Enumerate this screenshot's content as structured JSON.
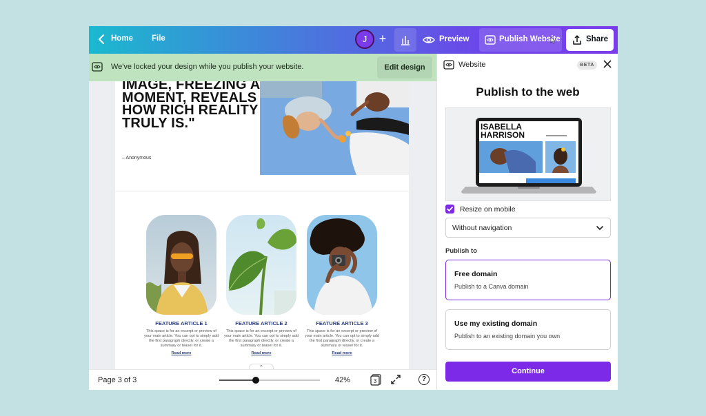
{
  "topbar": {
    "home_label": "Home",
    "file_label": "File",
    "avatar_initial": "J",
    "plus_symbol": "+",
    "preview_label": "Preview",
    "publish_label": "Publish Website",
    "share_label": "Share"
  },
  "banner": {
    "message": "We've locked your design while you publish your website.",
    "edit_label": "Edit design"
  },
  "page": {
    "quote": "IMAGE, FREEZING A MOMENT, REVEALS HOW RICH REALITY TRULY IS.\"",
    "author": "– Anonymous",
    "articles": [
      {
        "title": "FEATURE ARTICLE 1",
        "body": "This space is for an excerpt or preview of your main article. You can opt to simply add the first paragraph directly, or create a summary or teaser for it.",
        "more": "Read more"
      },
      {
        "title": "FEATURE ARTICLE 2",
        "body": "This space is for an excerpt or preview of your main article. You can opt to simply add the first paragraph directly, or create a summary or teaser for it.",
        "more": "Read more"
      },
      {
        "title": "FEATURE ARTICLE 3",
        "body": "This space is for an excerpt or preview of your main article. You can opt to simply add the first paragraph directly, or create a summary or teaser for it.",
        "more": "Read more"
      }
    ]
  },
  "bottombar": {
    "page_indicator": "Page 3 of 3",
    "zoom_value": "42%",
    "zoom_fraction": 0.36,
    "pages_count": "3",
    "help_symbol": "?"
  },
  "panel": {
    "title": "Website",
    "beta_label": "BETA",
    "heading": "Publish to the web",
    "preview_name": "ISABELLA HARRISON",
    "resize_label": "Resize on mobile",
    "resize_checked": true,
    "nav_select_value": "Without navigation",
    "publish_to_label": "Publish to",
    "options": [
      {
        "title": "Free domain",
        "desc": "Publish to a Canva domain",
        "selected": true
      },
      {
        "title": "Use my existing domain",
        "desc": "Publish to an existing domain you own",
        "selected": false
      }
    ],
    "continue_label": "Continue"
  },
  "colors": {
    "accent": "#7d2ae8",
    "banner_bg": "#bfe3bf",
    "backdrop": "#c3e0e3"
  }
}
